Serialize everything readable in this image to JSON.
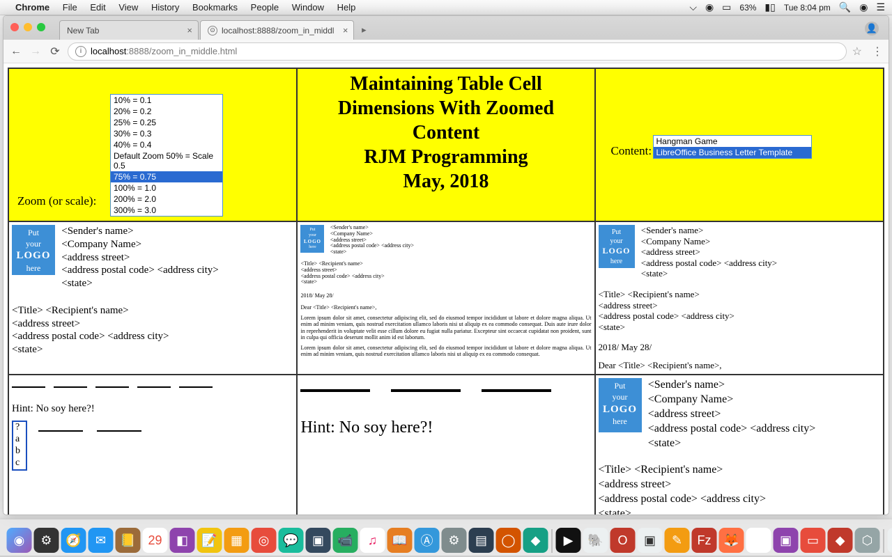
{
  "menubar": {
    "app": "Chrome",
    "items": [
      "File",
      "Edit",
      "View",
      "History",
      "Bookmarks",
      "People",
      "Window",
      "Help"
    ],
    "battery": "63%",
    "clock": "Tue 8:04 pm"
  },
  "tabs": {
    "t1": "New Tab",
    "t2": "localhost:8888/zoom_in_middl"
  },
  "url": {
    "host": "localhost",
    "port": ":8888",
    "path": "/zoom_in_middle.html"
  },
  "zoom": {
    "label": "Zoom (or scale):",
    "options": [
      "10% = 0.1",
      "20% = 0.2",
      "25% = 0.25",
      "30% = 0.3",
      "40% = 0.4",
      "Default Zoom 50% = Scale 0.5",
      "75% = 0.75",
      "100% = 1.0",
      "200% = 2.0",
      "300% = 3.0"
    ],
    "selected_index": 6
  },
  "title": {
    "l1": "Maintaining Table Cell",
    "l2": "Dimensions With Zoomed",
    "l3": "Content",
    "l4": "RJM Programming",
    "l5": "May, 2018"
  },
  "contentSel": {
    "label": "Content:",
    "options": [
      "Hangman Game",
      "LibreOffice Business Letter Template"
    ],
    "selected_index": 1
  },
  "letter": {
    "logo": {
      "l1": "Put",
      "l2": "your",
      "l3": "LOGO",
      "l4": "here"
    },
    "sender": [
      "<Sender's name>",
      "<Company Name>",
      "<address street>",
      "<address postal code> <address city>",
      "<state>"
    ],
    "recipient": [
      "<Title> <Recipient's name>",
      "<address street>",
      "<address postal code> <address city>",
      "<state>"
    ],
    "date": "2018/ May 28/",
    "salutation": "Dear <Title> <Recipient's name>,",
    "para1": "Lorem ipsum dolor sit amet, consectetur adipiscing elit, sed do eiusmod tempor incididunt ut labore et dolore magna aliqua. Ut enim ad minim veniam, quis nostrud exercitation ullamco laboris nisi ut aliquip ex ea commodo consequat. Duis aute irure dolor in reprehenderit in voluptate velit esse cillum dolore eu fugiat nulla pariatur. Excepteur sint occaecat cupidatat non proident, sunt in culpa qui officia deserunt mollit anim id est laborum.",
    "para2": "Lorem ipsum dolor sit amet, consectetur adipiscing elit, sed do eiusmod tempor incididunt ut labore et dolore magna aliqua. Ut enim ad minim veniam, quis nostrud exercitation ullamco laboris nisi ut aliquip ex ea commodo consequat."
  },
  "hangman": {
    "hint": "Hint: No soy here?!",
    "letters": [
      "?",
      "a",
      "b",
      "c"
    ]
  }
}
